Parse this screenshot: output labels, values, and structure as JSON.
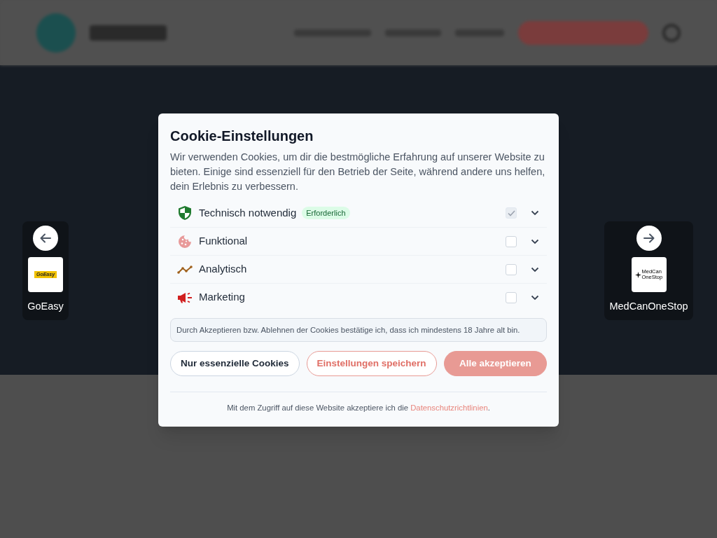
{
  "carousel": {
    "items": [
      {
        "name": "GoEasy",
        "logo_text": "GoEasy",
        "kind": "goeasy",
        "previous": true
      },
      {
        "name": "MedCanOneStop",
        "logo_text": "MedCan OneStop",
        "kind": "medcan",
        "previous": false
      }
    ]
  },
  "dialog": {
    "title": "Cookie-Einstellungen",
    "description": "Wir verwenden Cookies, um dir die bestmögliche Erfahrung auf unserer Website zu bieten. Einige sind essenziell für den Betrieb der Seite, während andere uns helfen, dein Erlebnis zu verbessern.",
    "categories": [
      {
        "kind": "necessary",
        "label": "Technisch notwendig",
        "badge": "Erforderlich",
        "checked": true,
        "disabled": true,
        "expanded": false
      },
      {
        "kind": "functional",
        "label": "Funktional",
        "checked": false,
        "disabled": false,
        "expanded": false
      },
      {
        "kind": "analytics",
        "label": "Analytisch",
        "checked": false,
        "disabled": false,
        "expanded": false
      },
      {
        "kind": "marketing",
        "label": "Marketing",
        "checked": false,
        "disabled": false,
        "expanded": false
      }
    ],
    "age_notice": "Durch Akzeptieren bzw. Ablehnen der Cookies bestätige ich, dass ich mindestens 18 Jahre alt bin.",
    "buttons": [
      {
        "label": "Nur essenzielle Cookies",
        "kind": "outline"
      },
      {
        "label": "Einstellungen speichern",
        "kind": "secondary"
      },
      {
        "label": "Alle akzeptieren",
        "kind": "primary"
      }
    ],
    "footer": {
      "text": "Mit dem Zugriff auf diese Website akzeptiere ich die",
      "link": "Datenschutzrichtlinien",
      "suffix": "."
    }
  }
}
